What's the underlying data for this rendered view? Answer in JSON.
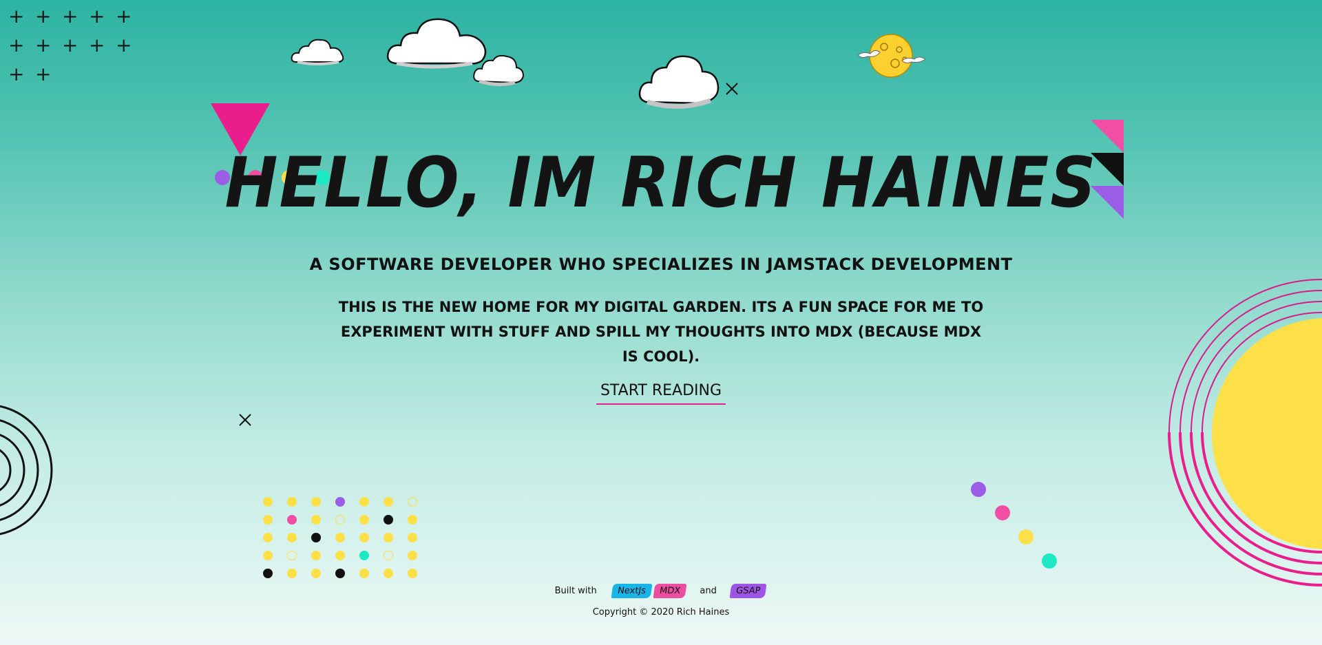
{
  "hero": {
    "title": "HELLO, IM RICH HAINES",
    "subtitle": "A SOFTWARE DEVELOPER WHO SPECIALIZES IN JAMSTACK DEVELOPMENT",
    "description": "THIS IS THE NEW HOME FOR MY DIGITAL GARDEN. ITS A FUN SPACE FOR ME TO EXPERIMENT WITH STUFF AND SPILL MY THOUGHTS INTO MDX (BECAUSE MDX IS COOL).",
    "cta_label": "START READING"
  },
  "footer": {
    "built_with": "Built with",
    "tech": [
      "NextJs",
      "MDX",
      "GSAP"
    ],
    "and": "and",
    "copyright": "Copyright © 2020 Rich Haines"
  },
  "colors": {
    "pink": "#e91e8c",
    "hot_pink": "#f04fa5",
    "purple": "#9b5de5",
    "yellow": "#fde047",
    "teal": "#1de9c4",
    "black": "#111111",
    "cyan_chip": "#19b5e8",
    "pink_chip": "#ec4f9f",
    "purple_chip": "#9e55e6"
  },
  "icons": {
    "plus": "+",
    "close": "×"
  },
  "matrix": [
    [
      "y",
      "y",
      "y",
      "p",
      "y",
      "y",
      "o"
    ],
    [
      "y",
      "m",
      "y",
      "o",
      "y",
      "k",
      "y"
    ],
    [
      "y",
      "y",
      "k",
      "y",
      "y",
      "y",
      "y"
    ],
    [
      "y",
      "o",
      "y",
      "y",
      "t",
      "o",
      "y"
    ],
    [
      "k",
      "y",
      "y",
      "k",
      "y",
      "y",
      "y"
    ]
  ]
}
